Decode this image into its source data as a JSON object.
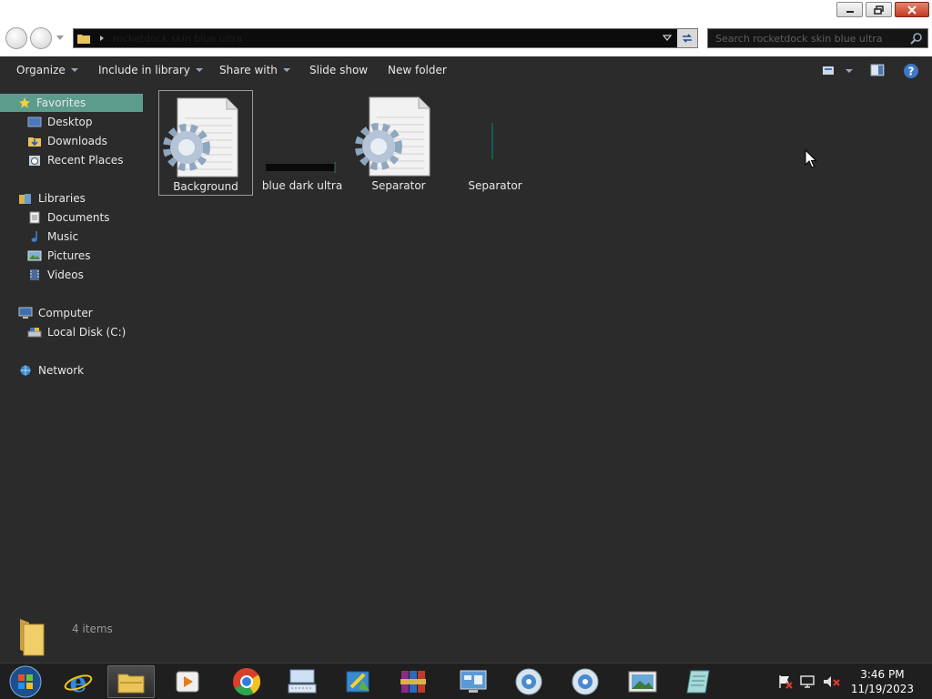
{
  "window": {
    "min_icon": "minimize-icon",
    "max_icon": "restore-icon",
    "close_icon": "close-icon"
  },
  "address": {
    "path": "rocketdock skin blue ultra",
    "search_placeholder": "Search rocketdock skin blue ultra"
  },
  "toolbar": {
    "organize": "Organize",
    "include_in_library": "Include in library",
    "share_with": "Share with",
    "slide_show": "Slide show",
    "new_folder": "New folder"
  },
  "sidebar": {
    "favorites": {
      "label": "Favorites",
      "items": [
        "Desktop",
        "Downloads",
        "Recent Places"
      ]
    },
    "libraries": {
      "label": "Libraries",
      "items": [
        "Documents",
        "Music",
        "Pictures",
        "Videos"
      ]
    },
    "computer": {
      "label": "Computer",
      "items": [
        "Local Disk (C:)"
      ]
    },
    "network": {
      "label": "Network"
    }
  },
  "files": [
    {
      "name": "Background",
      "icon": "settings-file-icon",
      "selected": true
    },
    {
      "name": "blue dark ultra",
      "icon": "image-thumbnail-icon",
      "selected": false
    },
    {
      "name": "Separator",
      "icon": "settings-file-icon",
      "selected": false
    },
    {
      "name": "Separator",
      "icon": "image-thumbnail-icon",
      "selected": false
    }
  ],
  "details": {
    "count": "4 items"
  },
  "taskbar": {
    "apps": [
      "start-orb",
      "internet-explorer",
      "windows-explorer",
      "media-player",
      "chrome",
      "keyboard-app",
      "paint-app",
      "winrar",
      "control-panel",
      "dvd-app-1",
      "dvd-app-2",
      "photo-viewer",
      "notepad-app"
    ],
    "time": "3:46 PM",
    "date": "11/19/2023"
  },
  "colors": {
    "selection": "#5c9c8c",
    "background": "#2b2b2b",
    "accent_teal": "#0a6d5c"
  }
}
